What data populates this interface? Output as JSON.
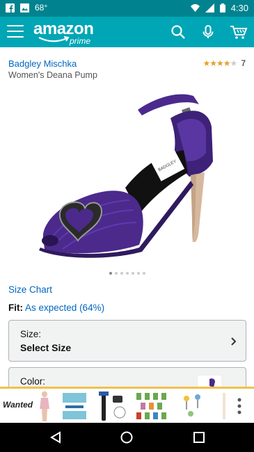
{
  "status_bar": {
    "temperature": "68°",
    "time": "4:30"
  },
  "app_bar": {
    "logo_text": "amazon",
    "logo_sub": "prime"
  },
  "product": {
    "brand": "Badgley Mischka",
    "name": "Women's Deana Pump",
    "rating_count": "7",
    "stars": 4,
    "image_count": 7,
    "active_image": 0
  },
  "size_chart_label": "Size Chart",
  "fit": {
    "label": "Fit:",
    "value": "As expected (64%)"
  },
  "size_selector": {
    "label": "Size:",
    "value": "Select Size"
  },
  "color_selector": {
    "label": "Color:"
  },
  "ad_banner": {
    "label": "Wanted"
  },
  "colors": {
    "teal_bar": "#00a6b5",
    "status_bar": "#00838f",
    "link": "#0066c0",
    "star": "#e3a12e",
    "shoe": "#4b2a8c"
  }
}
